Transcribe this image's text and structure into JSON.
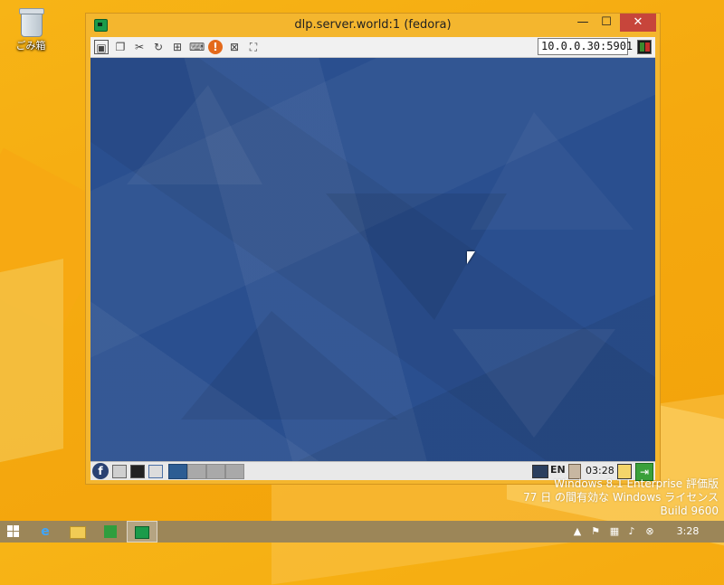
{
  "desktop": {
    "recycle_bin_label": "ごみ箱"
  },
  "window": {
    "title": "dlp.server.world:1 (fedora)",
    "buttons": {
      "minimize": "—",
      "maximize": "☐",
      "close": "✕"
    }
  },
  "toolbar": {
    "icons": [
      "connection-info-icon",
      "options-icon",
      "settings-tools-icon",
      "refresh-icon",
      "ctrl-alt-del-icon",
      "keyboard-icon",
      "alert-icon",
      "disconnect-icon",
      "fullscreen-icon"
    ],
    "address_value": "10.0.0.30:5901"
  },
  "remote_desktop": {
    "taskbar": {
      "language": "EN",
      "time": "03:28"
    }
  },
  "watermark": {
    "line1": "Windows 8.1 Enterprise 評価版",
    "line2": "77 日 の間有効な Windows ライセンス",
    "line3": "Build 9600"
  },
  "taskbar": {
    "clock": "3:28",
    "tray_icons": [
      "up-arrow-icon",
      "flag-icon",
      "network-icon",
      "volume-icon",
      "close-circle-icon"
    ]
  },
  "colors": {
    "desktop_bg": "#f5a90f",
    "window_frame": "#f4b62e",
    "remote_bg": "#2a4f8f",
    "close_button": "#c7453b",
    "taskbar": "#9c8658"
  }
}
